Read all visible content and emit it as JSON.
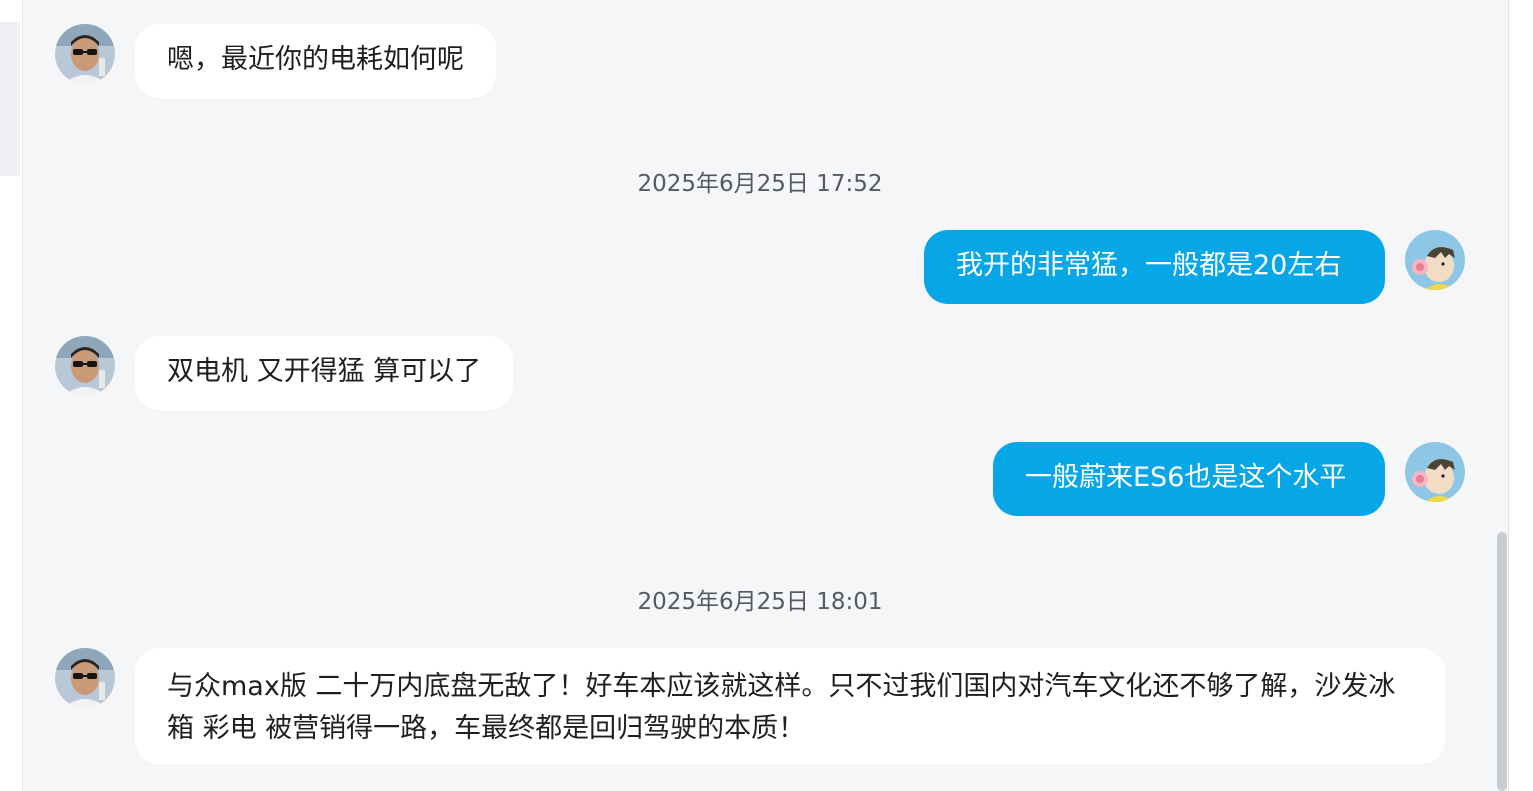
{
  "conversation": {
    "messages": [
      {
        "sender": "other",
        "text": "嗯，最近你的电耗如何呢"
      },
      {
        "sender": "self",
        "text": "我开的非常猛，一般都是20左右"
      },
      {
        "sender": "other",
        "text": "双电机 又开得猛 算可以了"
      },
      {
        "sender": "self",
        "text": "一般蔚来ES6也是这个水平"
      },
      {
        "sender": "other",
        "text": "与众max版 二十万内底盘无敌了！好车本应该就这样。只不过我们国内对汽车文化还不够了解，沙发冰箱 彩电 被营销得一路，车最终都是回归驾驶的本质！"
      }
    ],
    "timestamps": [
      "2025年6月25日 17:52",
      "2025年6月25日 18:01"
    ]
  },
  "colors": {
    "self_bubble": "#07a6e6",
    "other_bubble": "#ffffff",
    "background": "#f5f6f8"
  },
  "icons": {
    "other_avatar": "person-photo-avatar",
    "self_avatar": "cartoon-boy-avatar"
  }
}
